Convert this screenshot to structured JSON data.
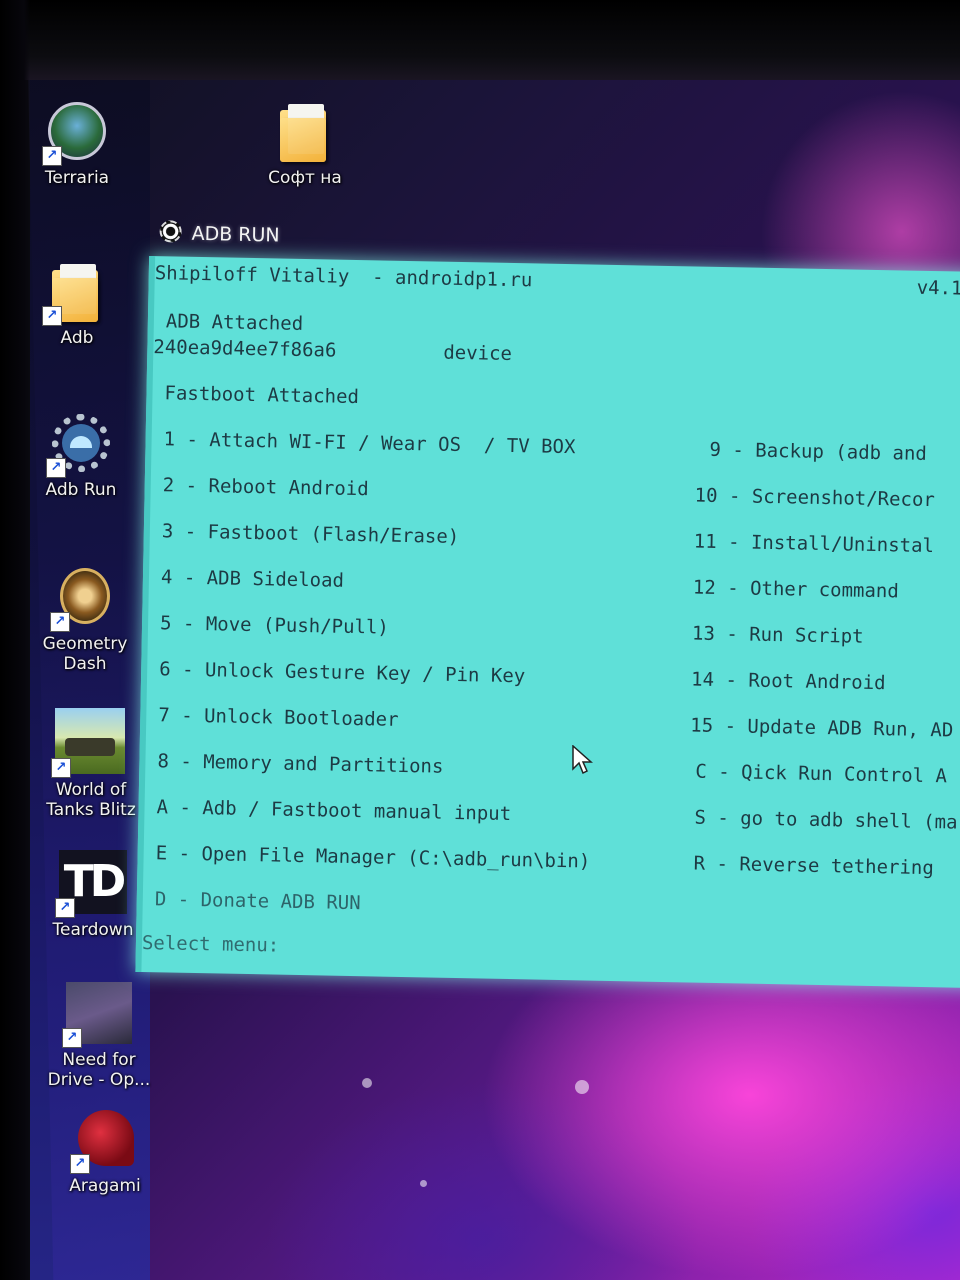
{
  "desktop": {
    "icons": [
      {
        "label": "Terraria",
        "icon": "terraria-icon",
        "shortcut": true
      },
      {
        "label": "Софт на",
        "icon": "folder-icon",
        "shortcut": false
      },
      {
        "label": "Adb",
        "icon": "folder-icon",
        "shortcut": true
      },
      {
        "label": "Adb Run",
        "icon": "android-gear-icon",
        "shortcut": true
      },
      {
        "label": "Geometry Dash",
        "icon": "geometry-dash-icon",
        "shortcut": true
      },
      {
        "label": "World of Tanks Blitz",
        "icon": "tank-icon",
        "shortcut": true
      },
      {
        "label": "Teardown",
        "icon": "teardown-icon",
        "shortcut": true
      },
      {
        "label": "Need for Drive - Op...",
        "icon": "car-game-icon",
        "shortcut": true
      },
      {
        "label": "Aragami",
        "icon": "aragami-icon",
        "shortcut": true
      }
    ],
    "teardown_glyph": "TD",
    "shortcut_glyph": "↗"
  },
  "adb_window": {
    "title": "ADB RUN",
    "header_author": "Shipiloff Vitaliy  - androidp1.ru",
    "version": "v4.1",
    "adb_status": "ADB Attached",
    "device_serial": "240ea9d4ee7f86a6",
    "device_state": "device",
    "fastboot_status": "Fastboot Attached",
    "menu_left": [
      "1 - Attach WI-FI / Wear OS  / TV BOX",
      "2 - Reboot Android",
      "3 - Fastboot (Flash/Erase)",
      "4 - ADB Sideload",
      "5 - Move (Push/Pull)",
      "6 - Unlock Gesture Key / Pin Key",
      "7 - Unlock Bootloader",
      "8 - Memory and Partitions",
      "A - Adb / Fastboot manual input",
      "E - Open File Manager (C:\\adb_run\\bin)",
      "D - Donate ADB RUN"
    ],
    "menu_right": [
      "9 - Backup (adb and",
      "10 - Screenshot/Recor",
      "11 - Install/Uninstal",
      "12 - Other command",
      "13 - Run Script",
      "14 - Root Android",
      "15 - Update ADB Run, AD",
      "C - Qick Run Control A",
      "S - go to adb shell (ma",
      "R - Reverse tethering"
    ],
    "prompt": "Select menu:"
  },
  "colors": {
    "console_bg": "#5fe0d8",
    "console_text": "#1d3a44",
    "wallpaper_accent": "#c22ad0"
  }
}
